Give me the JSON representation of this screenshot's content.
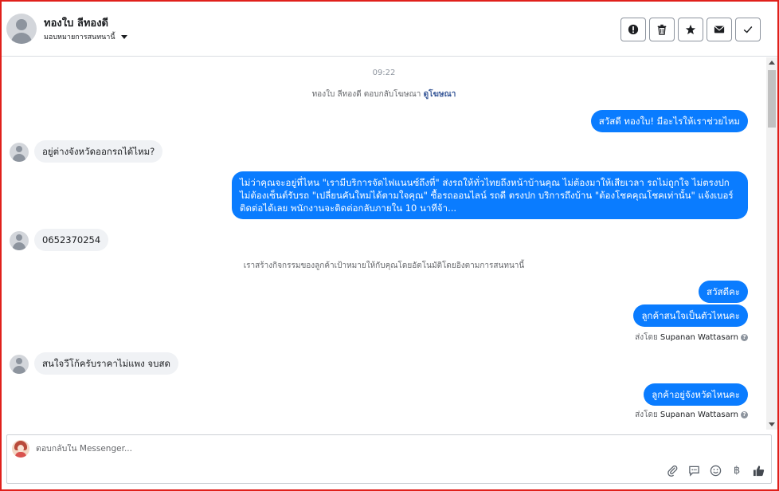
{
  "header": {
    "contact_name": "ทองใบ ลีทองดี",
    "assign_label": "มอบหมายการสนทนานี้",
    "actions": [
      {
        "name": "mark-spam",
        "icon": "exclamation-circle-icon"
      },
      {
        "name": "delete",
        "icon": "trash-icon"
      },
      {
        "name": "star",
        "icon": "star-icon"
      },
      {
        "name": "mark-unread",
        "icon": "envelope-icon"
      },
      {
        "name": "done",
        "icon": "check-icon"
      }
    ]
  },
  "conversation": {
    "timestamp": "09:22",
    "ad_reply_prefix": "ทองใบ ลีทองดี ตอบกลับโฆษณา",
    "ad_reply_link": "ดูโฆษณา",
    "msg_out_1": "สวัสดี ทองใบ! มีอะไรให้เราช่วยไหม",
    "msg_in_1": "อยู่ต่างจังหวัดออกรถได้ไหม?",
    "msg_out_2": "ไม่ว่าคุณจะอยู่ที่ไหน \"เรามีบริการจัดไฟแนนซ์ถึงที่\"  ส่งรถให้ทั่วไทยถึงหน้าบ้านคุณ ไม่ต้องมาให้เสียเวลา รถไม่ถูกใจ ไม่ตรงปก ไม่ต้องเซ็นต์รับรถ \"เปลี่ยนคันใหม่ได้ตามใจคุณ\" ซื้อรถออนไลน์ รถดี ตรงปก บริการถึงบ้าน \"ต้องโชคคุณโชคเท่านั้น\" แจ้งเบอร์ติดต่อได้เลย พนักงานจะติดต่อกลับภายใน 10 นาทีจ้า...",
    "msg_in_2": "0652370254",
    "system_note": "เราสร้างกิจกรรมของลูกค้าเป้าหมายให้กับคุณโดยอัตโนมัติโดยอิงตามการสนทนานี้",
    "msg_out_3": "สวัสดีคะ",
    "msg_out_4": "ลูกค้าสนใจเป็นตัวไหนคะ",
    "sent_by_prefix": "ส่งโดย",
    "sent_by_name": "Supanan Wattasarn",
    "msg_in_3": "สนใจวีโก้ครับราคาไม่แพง จบสด",
    "msg_out_5": "ลูกค้าอยู่จังหวัดไหนคะ",
    "sent_by_prefix_2": "ส่งโดย",
    "sent_by_name_2": "Supanan Wattasarn"
  },
  "composer": {
    "placeholder": "ตอบกลับใน Messenger...",
    "currency_symbol": "฿",
    "tools": [
      "paperclip-icon",
      "saved-replies-icon",
      "emoji-icon",
      "currency-icon",
      "thumbs-up-icon"
    ]
  },
  "colors": {
    "accent": "#0a7cff",
    "incoming_bubble": "#f0f2f5",
    "frame_border": "#e0201b"
  }
}
